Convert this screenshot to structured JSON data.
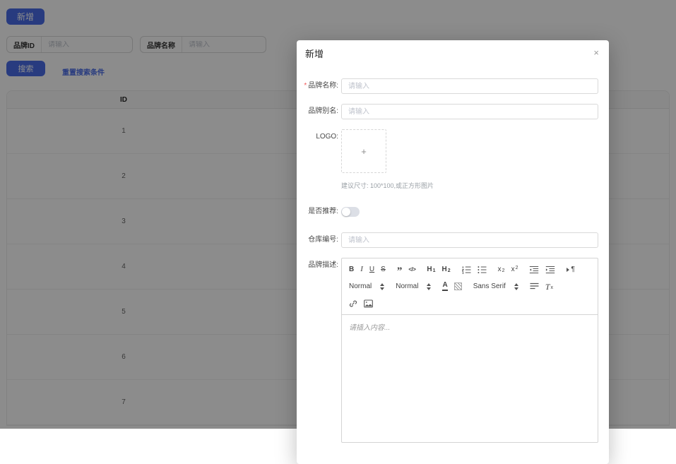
{
  "page": {
    "add_button": "新增",
    "filters": [
      {
        "label": "品牌ID",
        "placeholder": "请输入"
      },
      {
        "label": "品牌名称",
        "placeholder": "请输入"
      }
    ],
    "search_button": "搜索",
    "reset_link": "重置搜索条件",
    "table": {
      "header": [
        "ID"
      ],
      "rows": [
        {
          "id": "1"
        },
        {
          "id": "2"
        },
        {
          "id": "3"
        },
        {
          "id": "4"
        },
        {
          "id": "5"
        },
        {
          "id": "6"
        },
        {
          "id": "7"
        }
      ]
    }
  },
  "modal": {
    "title": "新增",
    "close_icon": "×",
    "form": {
      "brand_name": {
        "label": "品牌名称:",
        "required_mark": "*",
        "placeholder": "请输入"
      },
      "brand_alias": {
        "label": "品牌别名:",
        "placeholder": "请输入"
      },
      "logo": {
        "label": "LOGO:",
        "upload_icon": "+",
        "hint": "建议尺寸: 100*100,或正方形图片"
      },
      "recommend": {
        "label": "是否推荐:",
        "state": "off"
      },
      "warehouse_no": {
        "label": "仓库编号:",
        "placeholder": "请输入"
      },
      "description": {
        "label": "品牌描述:",
        "placeholder": "请插入内容..."
      }
    },
    "toolbar": {
      "bold": "B",
      "italic": "I",
      "underline": "U",
      "strike": "S",
      "blockquote": "”",
      "code_block": "</>",
      "h1_base": "H",
      "h1_sub": "1",
      "h2_base": "H",
      "h2_sub": "2",
      "sub_base": "x",
      "sub_mark": "2",
      "sup_base": "x",
      "sup_mark": "2",
      "direction_mark": "¶",
      "size_picker": "Normal",
      "header_picker": "Normal",
      "color_letter": "A",
      "font_picker": "Sans Serif",
      "clean_base": "T",
      "clean_mark": "x"
    }
  },
  "colors": {
    "primary": "#4a6ce8",
    "mask": "rgba(0,0,0,0.45)",
    "required": "#f25a5a",
    "placeholder": "#bfc3cc",
    "input_border": "#d9d9d9",
    "switch_off": "#dcdfe6"
  }
}
